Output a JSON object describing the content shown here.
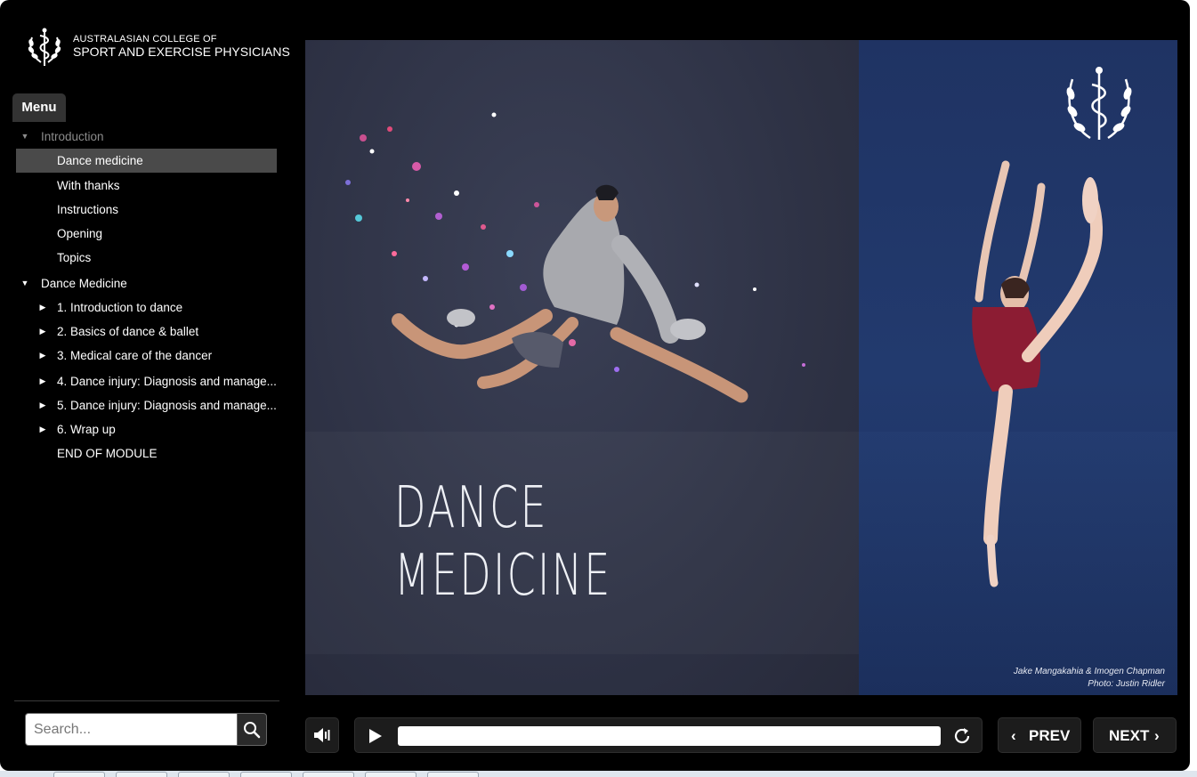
{
  "logo": {
    "line1": "AUSTRALASIAN COLLEGE OF",
    "line2": "SPORT AND EXERCISE PHYSICIANS",
    "icon": "caduceus-laurel-icon"
  },
  "menu_tab": "Menu",
  "menu": {
    "sections": [
      {
        "label": "Introduction",
        "expanded": true,
        "items": [
          {
            "label": "Dance medicine",
            "active": true
          },
          {
            "label": "With thanks"
          },
          {
            "label": "Instructions"
          },
          {
            "label": "Opening"
          },
          {
            "label": "Topics"
          }
        ]
      },
      {
        "label": "Dance Medicine",
        "expanded": true,
        "items": [
          {
            "label": "1. Introduction to dance",
            "collapsible": true
          },
          {
            "label": "2. Basics of dance & ballet",
            "collapsible": true
          },
          {
            "label": "3. Medical care of the dancer",
            "collapsible": true
          },
          {
            "label": "4. Dance injury: Diagnosis and manage...",
            "collapsible": true
          },
          {
            "label": "5. Dance injury: Diagnosis and manage...",
            "collapsible": true
          },
          {
            "label": "6. Wrap up",
            "collapsible": true
          },
          {
            "label": "END OF MODULE"
          }
        ]
      }
    ]
  },
  "search": {
    "placeholder": "Search...",
    "icon": "search-icon"
  },
  "slide": {
    "title_line1": "DANCE",
    "title_line2": "MEDICINE",
    "credit_line1": "Jake Mangakahia & Imogen Chapman",
    "credit_line2": "Photo: Justin Ridler",
    "colors": {
      "left_bg": "#2e3245",
      "right_bg": "#223a6e"
    }
  },
  "controls": {
    "volume_icon": "volume-icon",
    "play_icon": "play-icon",
    "replay_icon": "replay-icon",
    "progress": 0,
    "prev_label": "PREV",
    "next_label": "NEXT"
  }
}
